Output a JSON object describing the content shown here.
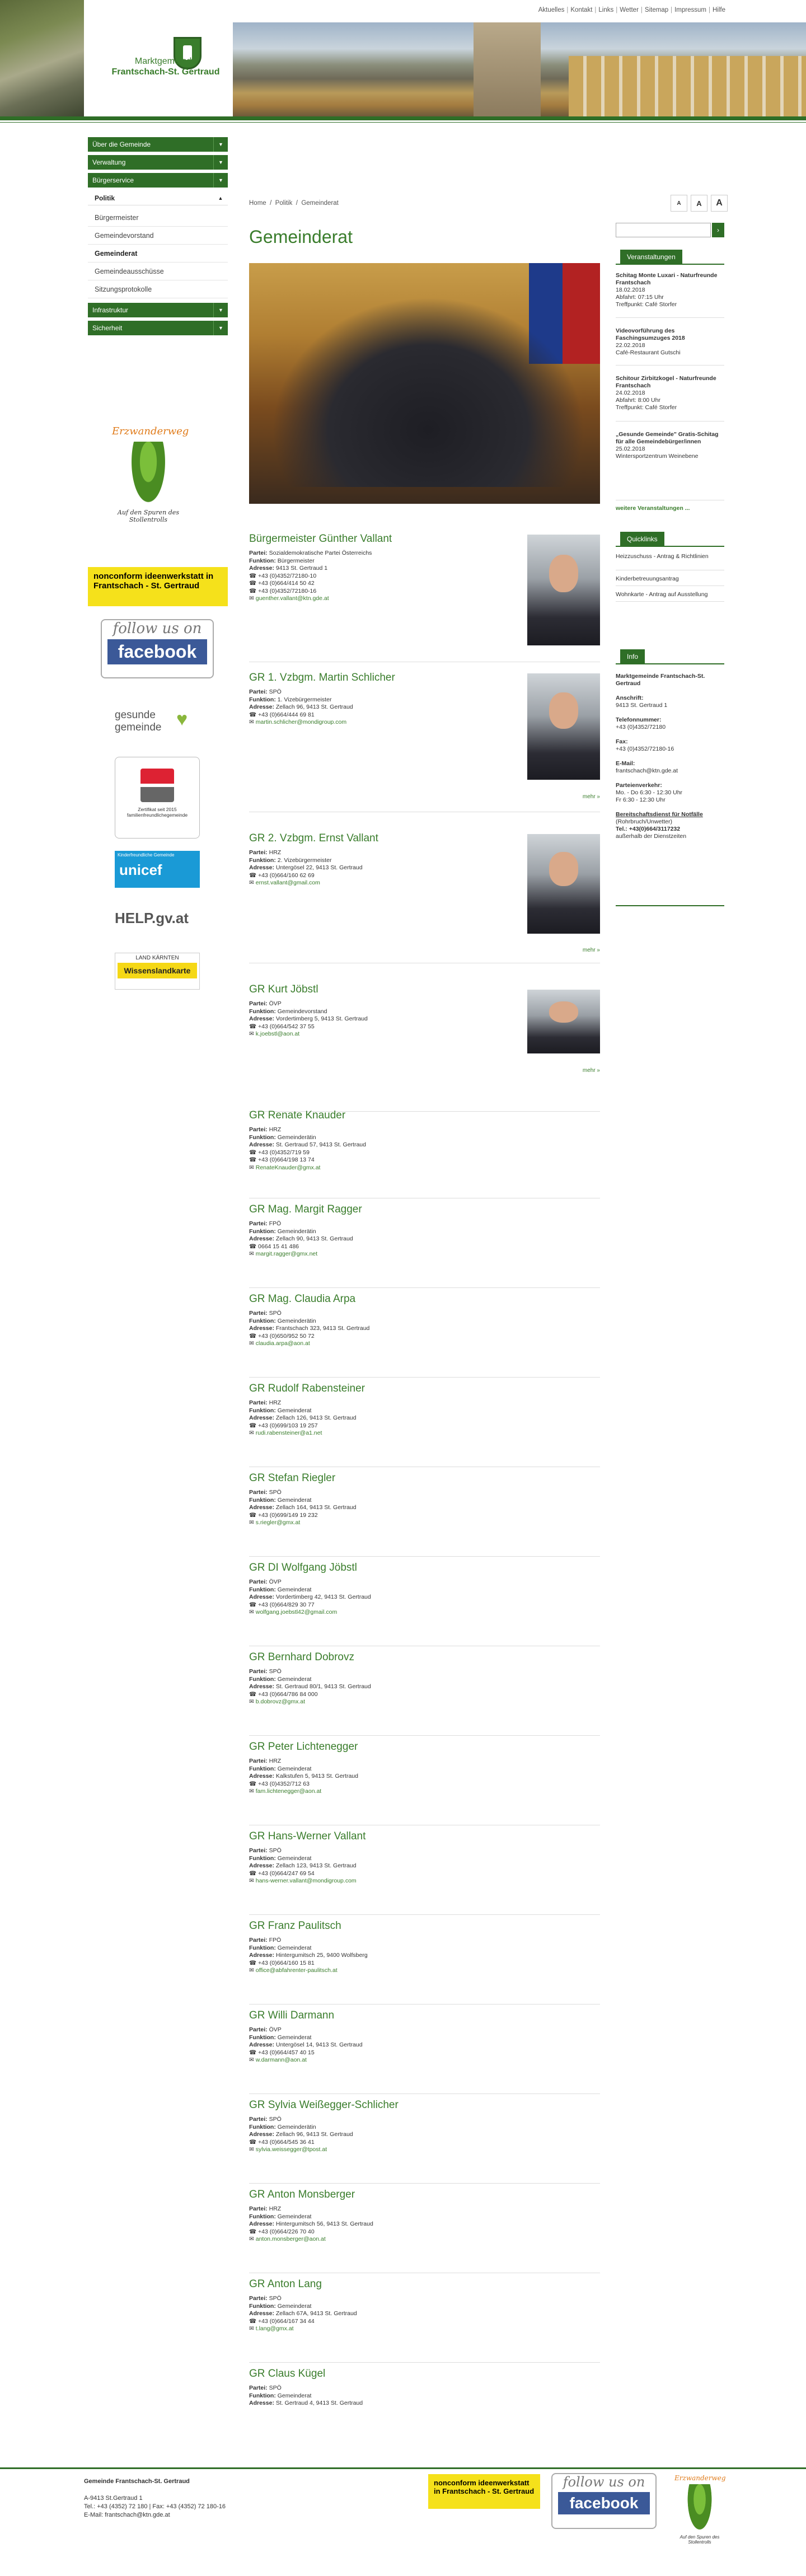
{
  "topnav": [
    "Aktuelles",
    "Kontakt",
    "Links",
    "Wetter",
    "Sitemap",
    "Impressum",
    "Hilfe"
  ],
  "logo": {
    "line1": "Marktgemeinde",
    "line2": "Frantschach-St. Gertraud"
  },
  "nav": {
    "items": [
      {
        "label": "Über die Gemeinde",
        "arrow": "▼"
      },
      {
        "label": "Verwaltung",
        "arrow": "▼"
      },
      {
        "label": "Bürgerservice",
        "arrow": "▼"
      },
      {
        "label": "Politik",
        "arrow": "▲"
      }
    ],
    "subitems": [
      "Bürgermeister",
      "Gemeindevorstand",
      "Gemeinderat",
      "Gemeindeausschüsse",
      "Sitzungsprotokolle"
    ],
    "after": [
      {
        "label": "Infrastruktur",
        "arrow": "▼"
      },
      {
        "label": "Sicherheit",
        "arrow": "▼"
      }
    ]
  },
  "badges": {
    "erz_title": "Erzwanderweg",
    "erz_sub": "Auf den Spuren des Stollentrolls",
    "nonconform": "nonconform ideenwerkstatt in Frantschach - St. Gertraud",
    "fb_top": "follow us on",
    "fb_bottom": "facebook",
    "gesunde": "gesunde gemeinde",
    "zert": "Zertifikat seit 2015 familienfreundlichegemeinde",
    "unicef_top": "Kinderfreundliche Gemeinde",
    "unicef": "unicef",
    "help": "HELP.gv.at",
    "land": "LAND KÄRNTEN",
    "wissen": "Wissenslandkarte"
  },
  "breadcrumb": [
    "Home",
    "Politik",
    "Gemeinderat"
  ],
  "textsize": [
    "A",
    "A",
    "A"
  ],
  "title": "Gemeinderat",
  "labels": {
    "partei": "Partei:",
    "funktion": "Funktion:",
    "adresse": "Adresse:",
    "more": "mehr »"
  },
  "members": [
    {
      "name": "Bürgermeister Günther Vallant",
      "partei": "Sozialdemokratische Partei Österreichs",
      "funktion": "Bürgermeister",
      "adresse": "9413 St. Gertraud 1",
      "tel1": "+43 (0)4352/72180-10",
      "tel2": "+43 (0)664/414 50 42",
      "tel3": "+43 (0)4352/72180-16",
      "mail": "guenther.vallant@ktn.gde.at"
    },
    {
      "name": "GR 1. Vzbgm. Martin Schlicher",
      "partei": "SPÖ",
      "funktion": "1. Vizebürgermeister",
      "adresse": "Zellach 96, 9413 St. Gertraud",
      "tel1": "+43 (0)664/444 69 81",
      "mail": "martin.schlicher@mondigroup.com"
    },
    {
      "name": "GR 2. Vzbgm. Ernst Vallant",
      "partei": "HRZ",
      "funktion": "2. Vizebürgermeister",
      "adresse": "Untergösel 22, 9413 St. Gertraud",
      "tel1": "+43 (0)664/160 62 69",
      "mail": "ernst.vallant@gmail.com"
    },
    {
      "name": "GR Kurt Jöbstl",
      "partei": "ÖVP",
      "funktion": "Gemeindevorstand",
      "adresse": "Vordertimberg 5, 9413 St. Gertraud",
      "tel1": "+43 (0)664/542 37 55",
      "mail": "k.joebstl@aon.at"
    },
    {
      "name": "GR Renate Knauder",
      "partei": "HRZ",
      "funktion": "Gemeinderätin",
      "adresse": "St. Gertraud 57, 9413 St. Gertraud",
      "tel1": "+43 (0)4352/719 59",
      "tel2": "+43 (0)664/198 13 74",
      "mail": "RenateKnauder@gmx.at"
    },
    {
      "name": "GR Mag. Margit Ragger",
      "partei": "FPÖ",
      "funktion": "Gemeinderätin",
      "adresse": "Zellach 90, 9413 St. Gertraud",
      "tel1": "0664 15 41 486",
      "mail": "margit.ragger@gmx.net"
    },
    {
      "name": "GR Mag. Claudia Arpa",
      "partei": "SPÖ",
      "funktion": "Gemeinderätin",
      "adresse": "Frantschach 323, 9413 St. Gertraud",
      "tel1": "+43 (0)650/952 50 72",
      "mail": "claudia.arpa@aon.at"
    },
    {
      "name": "GR Rudolf Rabensteiner",
      "partei": "HRZ",
      "funktion": "Gemeinderat",
      "adresse": "Zellach 126, 9413 St. Gertraud",
      "tel1": "+43 (0)699/103 19 257",
      "mail": "rudi.rabensteiner@a1.net"
    },
    {
      "name": "GR Stefan Riegler",
      "partei": "SPÖ",
      "funktion": "Gemeinderat",
      "adresse": "Zellach 164, 9413 St. Gertraud",
      "tel1": "+43 (0)699/149 19 232",
      "mail": "s.riegler@gmx.at"
    },
    {
      "name": "GR DI Wolfgang Jöbstl",
      "partei": "ÖVP",
      "funktion": "Gemeinderat",
      "adresse": "Vordertimberg 42, 9413 St. Gertraud",
      "tel1": "+43 (0)664/829 30 77",
      "mail": "wolfgang.joebstl42@gmail.com"
    },
    {
      "name": "GR Bernhard Dobrovz",
      "partei": "SPÖ",
      "funktion": "Gemeinderat",
      "adresse": "St. Gertraud 80/1, 9413 St. Gertraud",
      "tel1": "+43 (0)664/786 84 000",
      "mail": "b.dobrovz@gmx.at"
    },
    {
      "name": "GR Peter Lichtenegger",
      "partei": "HRZ",
      "funktion": "Gemeinderat",
      "adresse": "Kalkstufen 5, 9413 St. Gertraud",
      "tel1": "+43 (0)4352/712 63",
      "mail": "fam.lichtenegger@aon.at"
    },
    {
      "name": "GR Hans-Werner Vallant",
      "partei": "SPÖ",
      "funktion": "Gemeinderat",
      "adresse": "Zellach 123, 9413 St. Gertraud",
      "tel1": "+43 (0)664/247 69 54",
      "mail": "hans-werner.vallant@mondigroup.com"
    },
    {
      "name": "GR Franz Paulitsch",
      "partei": "FPÖ",
      "funktion": "Gemeinderat",
      "adresse": "Hintergumitsch 25, 9400 Wolfsberg",
      "tel1": "+43 (0)664/160 15 81",
      "mail": "office@abfahrenter-paulitsch.at"
    },
    {
      "name": "GR Willi Darmann",
      "partei": "ÖVP",
      "funktion": "Gemeinderat",
      "adresse": "Untergösel 14, 9413 St. Gertraud",
      "tel1": "+43 (0)664/457 40 15",
      "mail": "w.darmann@aon.at"
    },
    {
      "name": "GR Sylvia Weißegger-Schlicher",
      "partei": "SPÖ",
      "funktion": "Gemeinderätin",
      "adresse": "Zellach 96, 9413 St. Gertraud",
      "tel1": "+43 (0)664/545 36 41",
      "mail": "sylvia.weissegger@tpost.at"
    },
    {
      "name": "GR Anton Monsberger",
      "partei": "HRZ",
      "funktion": "Gemeinderat",
      "adresse": "Hintergumitsch 56, 9413 St. Gertraud",
      "tel1": "+43 (0)664/226 70 40",
      "mail": "anton.monsberger@aon.at"
    },
    {
      "name": "GR Anton Lang",
      "partei": "SPÖ",
      "funktion": "Gemeinderat",
      "adresse": "Zellach 67A, 9413 St. Gertraud",
      "tel1": "+43 (0)664/167 34 44",
      "mail": "t.lang@gmx.at"
    },
    {
      "name": "GR Claus Kügel",
      "partei": "SPÖ",
      "funktion": "Gemeinderat",
      "adresse": "St. Gertraud 4, 9413 St. Gertraud"
    }
  ],
  "right": {
    "search_btn": "›",
    "veranst_title": "Veranstaltungen",
    "events": [
      {
        "title": "Schitag Monte Luxari - Naturfreunde Frantschach",
        "l1": "18.02.2018",
        "l2": "Abfahrt: 07:15 Uhr",
        "l3": "Treffpunkt: Café Storfer"
      },
      {
        "title": "Videovorführung des Faschingsumzuges 2018",
        "l1": "22.02.2018",
        "l2": "Café-Restaurant Gutschi"
      },
      {
        "title": "Schitour Zirbitzkogel - Naturfreunde Frantschach",
        "l1": "24.02.2018",
        "l2": "Abfahrt: 8:00 Uhr",
        "l3": "Treffpunkt: Café Storfer"
      },
      {
        "title": "„Gesunde Gemeinde\" Gratis-Schitag für alle Gemeindebürger/innen",
        "l1": "25.02.2018",
        "l2": "Wintersportzentrum Weinebene"
      }
    ],
    "more_events": "weitere Veranstaltungen ...",
    "quick_title": "Quicklinks",
    "quick": [
      "Heizzuschuss - Antrag & Richtlinien",
      "Kinderbetreuungsantrag",
      "Wohnkarte - Antrag auf Ausstellung"
    ],
    "info_title": "Info",
    "info_name": "Marktgemeinde Frantschach-St. Gertraud",
    "anschrift_l": "Anschrift:",
    "anschrift": "9413 St. Gertraud 1",
    "tel_l": "Telefonnummer:",
    "tel": "+43 (0)4352/72180",
    "fax_l": "Fax:",
    "fax": "+43 (0)4352/72180-16",
    "mail_l": "E-Mail:",
    "mail": "frantschach@ktn.gde.at",
    "pv_l": "Parteienverkehr:",
    "pv1": "Mo. - Do 6:30 - 12:30 Uhr",
    "pv2": "Fr 6:30 - 12:30 Uhr",
    "ber_l": "Bereitschaftsdienst für Notfälle",
    "ber_s": "(Rohrbruch/Unwetter)",
    "ber_tel": "Tel.: +43(0)664/3117232",
    "ber_note": "außerhalb der Dienstzeiten"
  },
  "footer": {
    "title": "Gemeinde Frantschach-St. Gertraud",
    "addr": "A-9413 St.Gertraud 1",
    "tel": "Tel.: +43 (4352) 72 180 | Fax: +43 (4352) 72 180-16",
    "mail": "E-Mail: frantschach@ktn.gde.at"
  }
}
